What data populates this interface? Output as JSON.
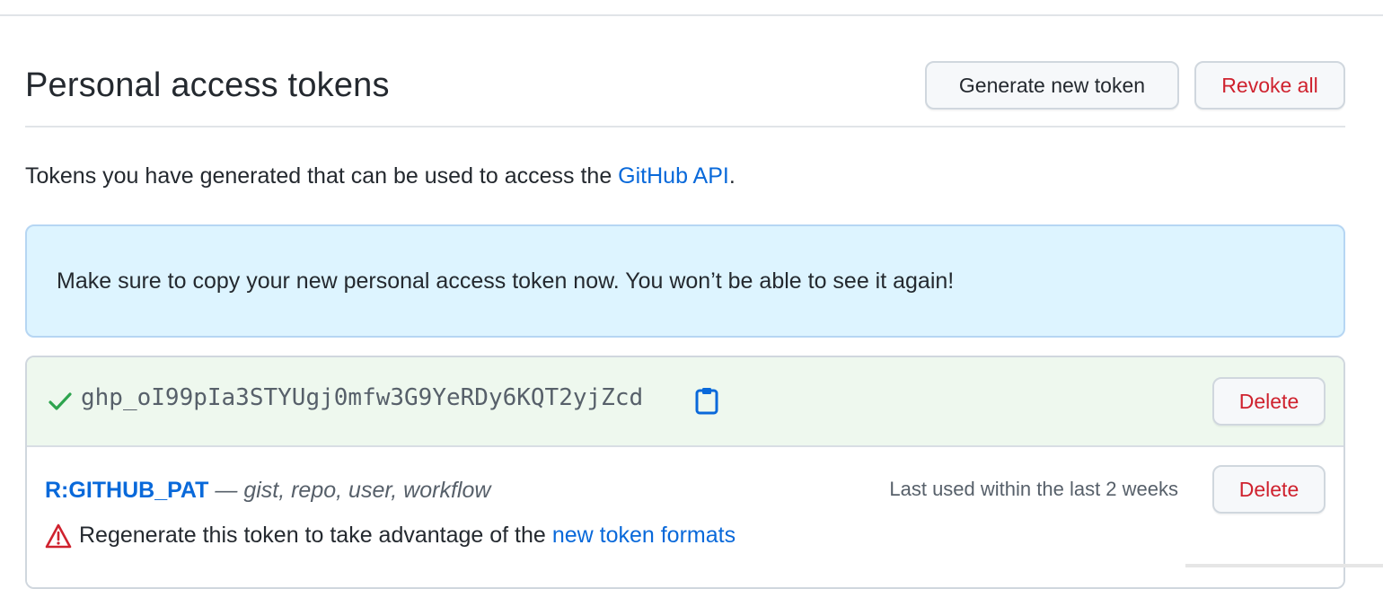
{
  "page": {
    "title": "Personal access tokens",
    "generate_label": "Generate new token",
    "revoke_label": "Revoke all"
  },
  "description": {
    "text": "Tokens you have generated that can be used to access the ",
    "link": "GitHub API",
    "suffix": "."
  },
  "flash": {
    "message": "Make sure to copy your new personal access token now. You won’t be able to see it again!"
  },
  "tokens": [
    {
      "value": "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",
      "delete_label": "Delete",
      "icon": "check-icon",
      "copy_icon": "clipboard-icon"
    },
    {
      "name": "R:GITHUB_PAT",
      "separator": "—",
      "scopes": "gist, repo, user, workflow",
      "last_used": "Last used within the last 2 weeks",
      "delete_label": "Delete",
      "warning_text": "Regenerate this token to take advantage of the",
      "warning_link": "new token formats",
      "warning_icon": "alert-icon"
    }
  ],
  "colors": {
    "link": "#0969da",
    "danger": "#cf222e",
    "success": "#2da44e",
    "flash_bg": "#ddf4ff",
    "new_token_bg": "#eef8ee"
  }
}
